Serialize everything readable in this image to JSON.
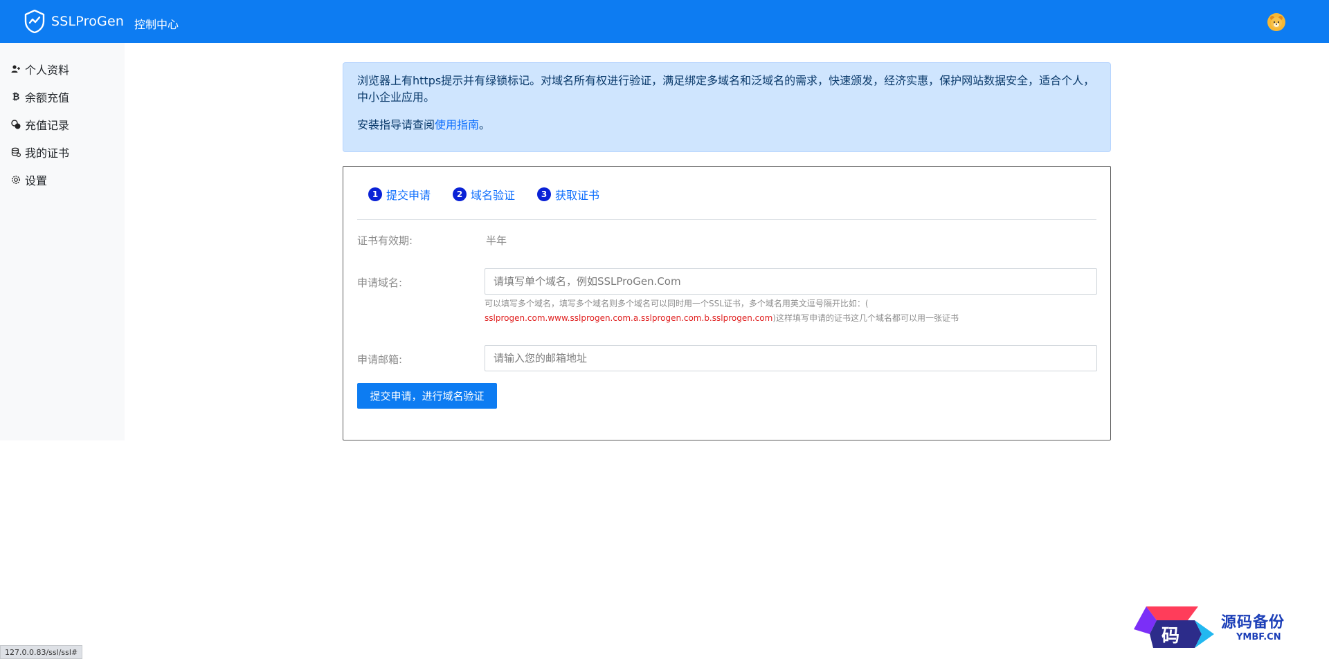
{
  "header": {
    "brand": "SSLProGen",
    "nav_item": "控制中心"
  },
  "sidebar": {
    "items": [
      {
        "label": "个人资料",
        "icon": "person-plus-icon"
      },
      {
        "label": "余额充值",
        "icon": "bitcoin-icon"
      },
      {
        "label": "充值记录",
        "icon": "coins-icon"
      },
      {
        "label": "我的证书",
        "icon": "database-icon"
      },
      {
        "label": "设置",
        "icon": "gear-icon"
      }
    ]
  },
  "alert": {
    "text": "浏览器上有https提示并有绿锁标记。对域名所有权进行验证，满足绑定多域名和泛域名的需求，快速颁发，经济实惠，保护网站数据安全，适合个人，中小企业应用。",
    "guide_prefix": "安装指导请查阅",
    "guide_link": "使用指南",
    "guide_suffix": "。"
  },
  "steps": [
    {
      "num": "1",
      "label": "提交申请"
    },
    {
      "num": "2",
      "label": "域名验证"
    },
    {
      "num": "3",
      "label": "获取证书"
    }
  ],
  "form": {
    "validity_label": "证书有效期:",
    "validity_value": "半年",
    "domain_label": "申请域名:",
    "domain_placeholder": "请填写单个域名，例如SSLProGen.Com",
    "domain_help_1": "可以填写多个域名，填写多个域名则多个域名可以同时用一个SSL证书，多个域名用英文逗号隔开比如：(",
    "domain_help_example": "sslprogen.com.www.sslprogen.com.a.sslprogen.com.b.sslprogen.com",
    "domain_help_2": ")这样填写申请的证书这几个域名都可以用一张证书",
    "email_label": "申请邮箱:",
    "email_placeholder": "请输入您的邮箱地址",
    "submit_label": "提交申请，进行域名验证"
  },
  "statusbar": {
    "url": "127.0.0.83/ssl/ssl#"
  },
  "watermark": {
    "title": "源码备份",
    "subtitle": "YMBF.CN"
  },
  "colors": {
    "primary": "#0d7cf2",
    "alert_bg": "#cfe5fe",
    "step_circle": "#0a22d6",
    "help_red": "#e02020"
  }
}
